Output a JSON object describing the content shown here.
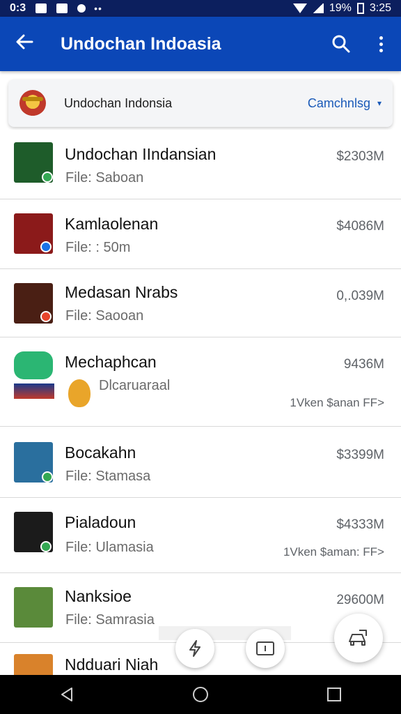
{
  "status_bar": {
    "time_left": "0:3",
    "battery_percent": "19%",
    "time_right": "3:25"
  },
  "app_bar": {
    "title": "Undochan Indoasia"
  },
  "filter": {
    "label": "Undochan Indonsia",
    "dropdown_value": "Camchnlsg"
  },
  "list": [
    {
      "name": "Undochan IIndansian",
      "sub": "File: Saboan",
      "size": "$2303M",
      "extra": "",
      "thumb_color": "#1e5c2a",
      "badge_color": "#34a853",
      "icon": "garuda-emblem-icon"
    },
    {
      "name": "Kamlaolenan",
      "sub": "File: : 50m",
      "size": "$4086M",
      "extra": "",
      "thumb_color": "#8b1a1a",
      "badge_color": "#1a73e8",
      "icon": "seal-emblem-icon"
    },
    {
      "name": "Medasan Nrabs",
      "sub": "File: Saooan",
      "size": "0,.039M",
      "extra": "",
      "thumb_color": "#4a1f14",
      "badge_color": "#e8452c",
      "icon": "character-icon"
    },
    {
      "name": "Mechaphcan",
      "sub": "Dlcaruaraal",
      "size": "9436M",
      "extra": "1Vken $anan FF>",
      "thumb_color": "#2bb673",
      "badge_color": "",
      "icon": "urah-logo-icon"
    },
    {
      "name": "Bocakahn",
      "sub": "File: Stamasa",
      "size": "$3399M",
      "extra": "",
      "thumb_color": "#2a6f9e",
      "badge_color": "#34a853",
      "icon": "person-portrait-icon"
    },
    {
      "name": "Pialadoun",
      "sub": "File: Ulamasia",
      "size": "$4333M",
      "extra": "1Vken $aman: FF>",
      "thumb_color": "#1b1b1b",
      "badge_color": "#34a853",
      "icon": "garuda-figure-icon"
    },
    {
      "name": "Nanksioe",
      "sub": "File: Samrasia",
      "size": "29600M",
      "extra": "",
      "thumb_color": "#5a8a3a",
      "badge_color": "",
      "icon": "landscape-logo-icon"
    },
    {
      "name": "Ndduari Niah",
      "sub": "",
      "size": "",
      "extra": "",
      "thumb_color": "#d9822b",
      "badge_color": "",
      "icon": "worker-icon"
    }
  ],
  "fabs": {
    "left_icon": "lightning-icon",
    "middle_icon": "info-card-icon",
    "right_icon": "car-share-icon"
  },
  "nav": {
    "back_icon": "back-triangle-icon",
    "home_icon": "home-circle-icon",
    "recents_icon": "recents-square-icon"
  }
}
